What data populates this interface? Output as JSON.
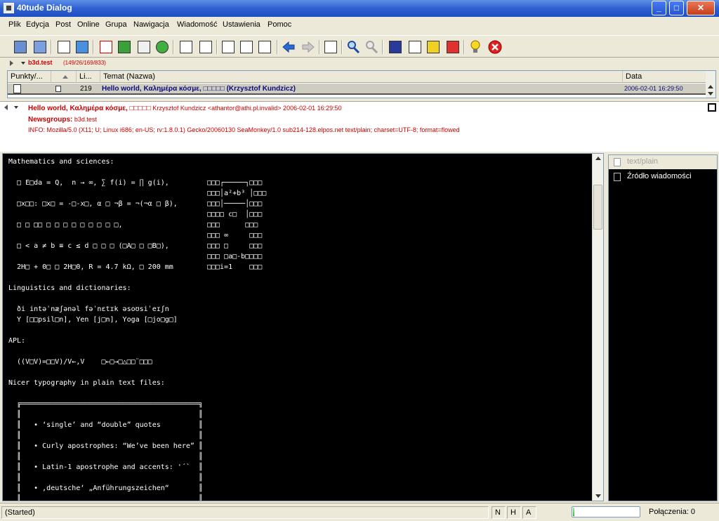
{
  "window": {
    "title": "40tude Dialog"
  },
  "menu": [
    "Plik",
    "Edycja",
    "Post",
    "Online",
    "Grupa",
    "Nawigacja",
    "Wiadomość",
    "Ustawienia",
    "Pomoc"
  ],
  "toolbar": {
    "icons": [
      "get-headers-icon",
      "get-all-icon",
      "download-icon",
      "download-blue-icon",
      "new-message-icon",
      "reply-icon",
      "mail-icon",
      "refresh-icon",
      "next-thread-icon",
      "next-unread-icon",
      "mark-read-icon",
      "mark-thread-icon",
      "mark-all-icon",
      "back-arrow-icon",
      "forward-arrow-icon",
      "view-icon",
      "search-icon",
      "search-disabled-icon",
      "folder-icon",
      "attachment-icon",
      "lock-icon",
      "filter-icon",
      "tip-icon",
      "stop-icon"
    ],
    "colors": {
      "back": "#2a6ad6",
      "stop": "#e02020",
      "tip": "#f8d820"
    }
  },
  "group": {
    "name": "b3d.test",
    "counts": "(149/26/169/833)"
  },
  "list": {
    "columns": [
      "Punkty/...",
      "Li...",
      "Temat (Nazwa)",
      "Data"
    ],
    "rows": [
      {
        "lines": "219",
        "subject": "Hello world, Καλημέρα κόσμε, □□□□□ (Krzysztof Kundzicz)",
        "date": "2006-02-01 16:29:50"
      }
    ]
  },
  "header": {
    "subject_bold": "Hello world, Καλημέρα κόσμε, □□□□□",
    "from": " Krzysztof Kundzicz <athantor@athi.pl.invalid> 2006-02-01 16:29:50",
    "newsgroups_label": "Newsgroups:",
    "newsgroups": " b3d.test",
    "info": "INFO: Mozilla/5.0 (X11; U; Linux i686; en-US; rv:1.8.0.1) Gecko/20060130 SeaMonkey/1.0 sub214-128.elpos.net text/plain; charset=UTF-8; format=flowed"
  },
  "body": {
    "lines": [
      "Mathematics and sciences:",
      "",
      "  □ E□da = Q,  n → ∞, ∑ f(i) = ∏ g(i),         □□□┌─────┐□□□",
      "                                               □□□│a²+b³ │□□□",
      "  □x□□: □x□ = -□-x□, α □ ¬β = ¬(¬α □ β),       □□□│─────│□□□",
      "                                               □□□□ c□  │□□□",
      "  □ □ □□ □ □ □ □ □ □ □ □ □,                    □□□      □□□",
      "                                               □□□ ∞     □□□",
      "  □ < a ≠ b ≡ c ≤ d □ □ □ (□A□ □ □B□),         □□□ □     □□□",
      "                                               □□□ □a□-b□□□□",
      "  2H□ + 0□ □ 2H□0, R = 4.7 kΩ, □ 200 mm        □□□i=1    □□□",
      "",
      "Linguistics and dictionaries:",
      "",
      "  ði intəˈnæʃənəl fəˈnɛtɪk əsoʊsiˈeɪʃn",
      "  Y [□□psil□n], Yen [j□n], Yoga [□jo□g□]",
      "",
      "APL:",
      "",
      "  ((V□V)=□□V)/V←,V    □←□→□△□□¨□□□",
      "",
      "Nicer typography in plain text files:",
      "",
      "  ╔══════════════════════════════════════════╗",
      "  ║                                          ║",
      "  ║   • ‘single’ and “double” quotes         ║",
      "  ║                                          ║",
      "  ║   • Curly apostrophes: “We’ve been here” ║",
      "  ║                                          ║",
      "  ║   • Latin-1 apostrophe and accents: '´`  ║",
      "  ║                                          ║",
      "  ║   • ‚deutsche‘ „Anführungszeichen“       ║",
      "  ║                                          ║"
    ]
  },
  "side": {
    "items": [
      "text/plain",
      "Źródło wiadomości"
    ]
  },
  "status": {
    "text": "(Started)",
    "flags": [
      "N",
      "H",
      "A"
    ],
    "progress": 0.02,
    "connections": "Połączenia: 0"
  }
}
